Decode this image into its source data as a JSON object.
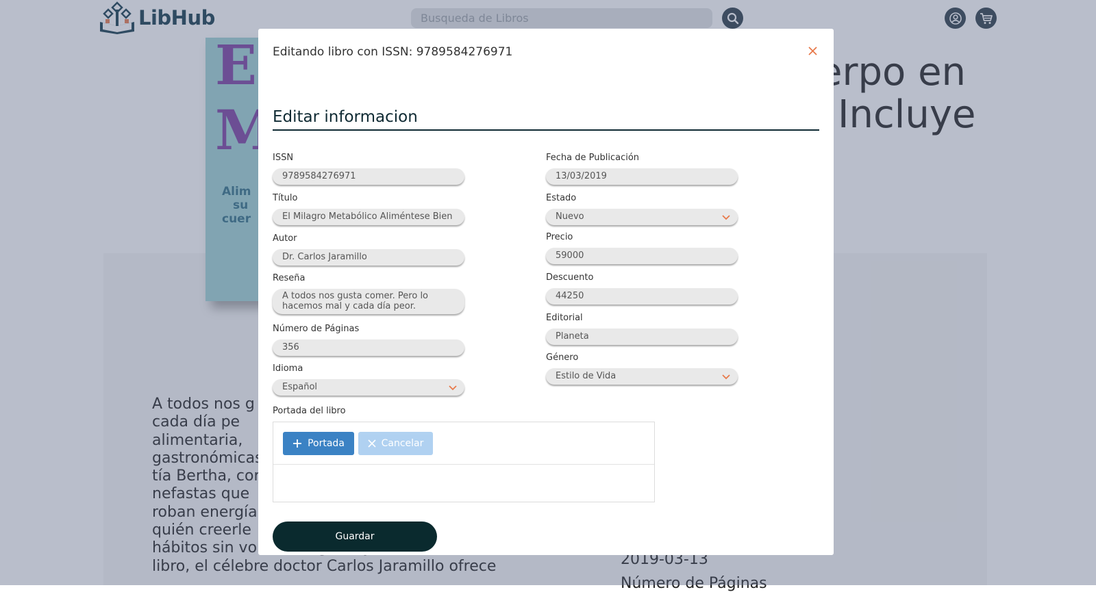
{
  "header": {
    "logo_text": "LibHub",
    "search_placeholder": "Busqueda de Libros"
  },
  "background": {
    "cover_letters": [
      "EL",
      "ME"
    ],
    "cover_subtitle": [
      "Alim",
      "su",
      "cuer"
    ],
    "title_fragments": [
      "erpo en",
      "Incluye",
      ")"
    ],
    "description_lines": [
      "A todos nos g",
      "cada día pe",
      "alimentaria,",
      "gastronómicas",
      "tía Bertha, cor",
      "nefastas que",
      "roban energía",
      "quién creerle",
      "hábitos sin volverse rígidos y obsesivos? En este",
      "libro, el célebre doctor Carlos Jaramillo ofrece"
    ],
    "date": "2019-03-13",
    "pages_label": "Número de Páginas"
  },
  "modal": {
    "header_title": "Editando libro con ISSN: 9789584276971",
    "section_title": "Editar informacion",
    "fields_left": [
      {
        "label": "ISSN",
        "value": "9789584276971"
      },
      {
        "label": "Título",
        "value": "El Milagro Metabólico  Aliméntese Bien"
      },
      {
        "label": "Autor",
        "value": "Dr. Carlos Jaramillo"
      },
      {
        "label": "Reseña",
        "value": "A todos nos gusta comer. Pero lo hacemos mal y cada día peor."
      },
      {
        "label": "Número de Páginas",
        "value": "356"
      },
      {
        "label": "Idioma",
        "value": "Español"
      }
    ],
    "fields_right": [
      {
        "label": "Fecha de Publicación",
        "value": "13/03/2019"
      },
      {
        "label": "Estado",
        "value": "Nuevo"
      },
      {
        "label": "Precio",
        "value": "59000"
      },
      {
        "label": "Descuento",
        "value": "44250"
      },
      {
        "label": "Editorial",
        "value": "Planeta"
      },
      {
        "label": "Género",
        "value": "Estilo de Vida"
      }
    ],
    "portada_label": "Portada del libro",
    "portada_button": "Portada",
    "cancel_button": "Cancelar",
    "save_button": "Guardar"
  },
  "colors": {
    "overlay": "#58648299",
    "primary_dark": "#0a2a2e",
    "upload_blue": "#3b82c4",
    "close_orange": "#e8794a"
  }
}
